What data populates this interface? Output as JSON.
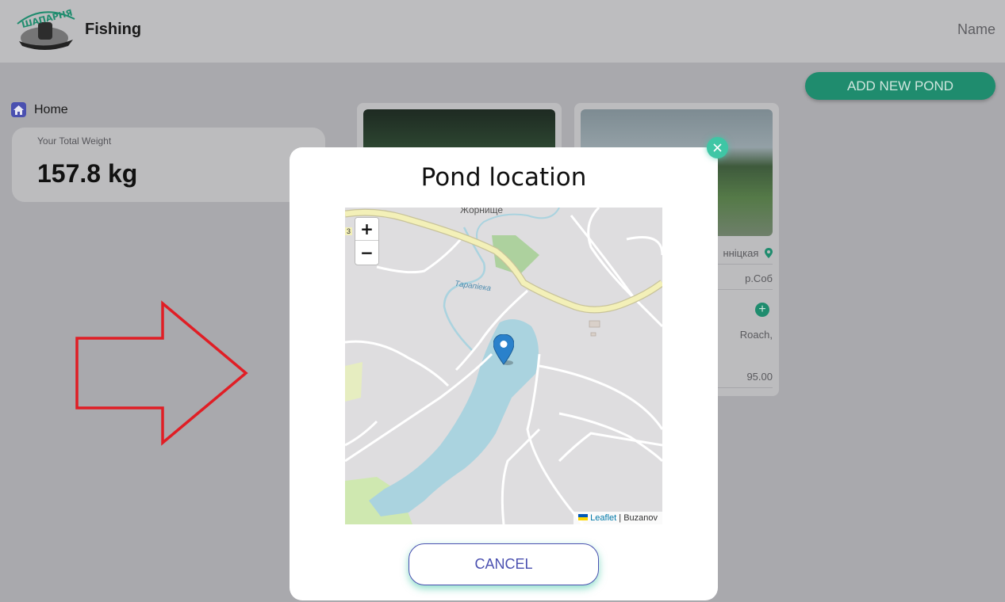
{
  "header": {
    "logo_text": "ШАПАРНЯ",
    "app_title": "Fishing",
    "user_name": "Name"
  },
  "actions": {
    "add_pond_label": "ADD NEW POND"
  },
  "nav": {
    "home_label": "Home"
  },
  "stats": {
    "total_weight_label": "Your Total Weight",
    "total_weight_value": "157.8 kg"
  },
  "pond_cards": [
    {
      "photo": "forest-canyon-photo"
    },
    {
      "photo": "lake-field-photo",
      "location": "нніцкая",
      "river": "р.Соб",
      "fish": "Roach,",
      "price": "95.00"
    }
  ],
  "modal": {
    "title": "Pond location",
    "cancel_label": "CANCEL",
    "map": {
      "town_label": "Жорнище",
      "river_label": "Тарапіека",
      "road_number": "3",
      "zoom_in": "+",
      "zoom_out": "−",
      "attribution_leaflet": "Leaflet",
      "attribution_sep": " | ",
      "attribution_author": "Buzanov"
    }
  },
  "colors": {
    "accent_green": "#1f8c6e",
    "close_teal": "#3fc6a5",
    "cancel_blue": "#4a50b0",
    "arrow_red": "#e01e25",
    "water": "#aad3df"
  },
  "icons": [
    "home-icon",
    "close-icon",
    "map-pin-icon",
    "map-marker-icon",
    "plus-icon",
    "ukraine-flag-icon"
  ]
}
